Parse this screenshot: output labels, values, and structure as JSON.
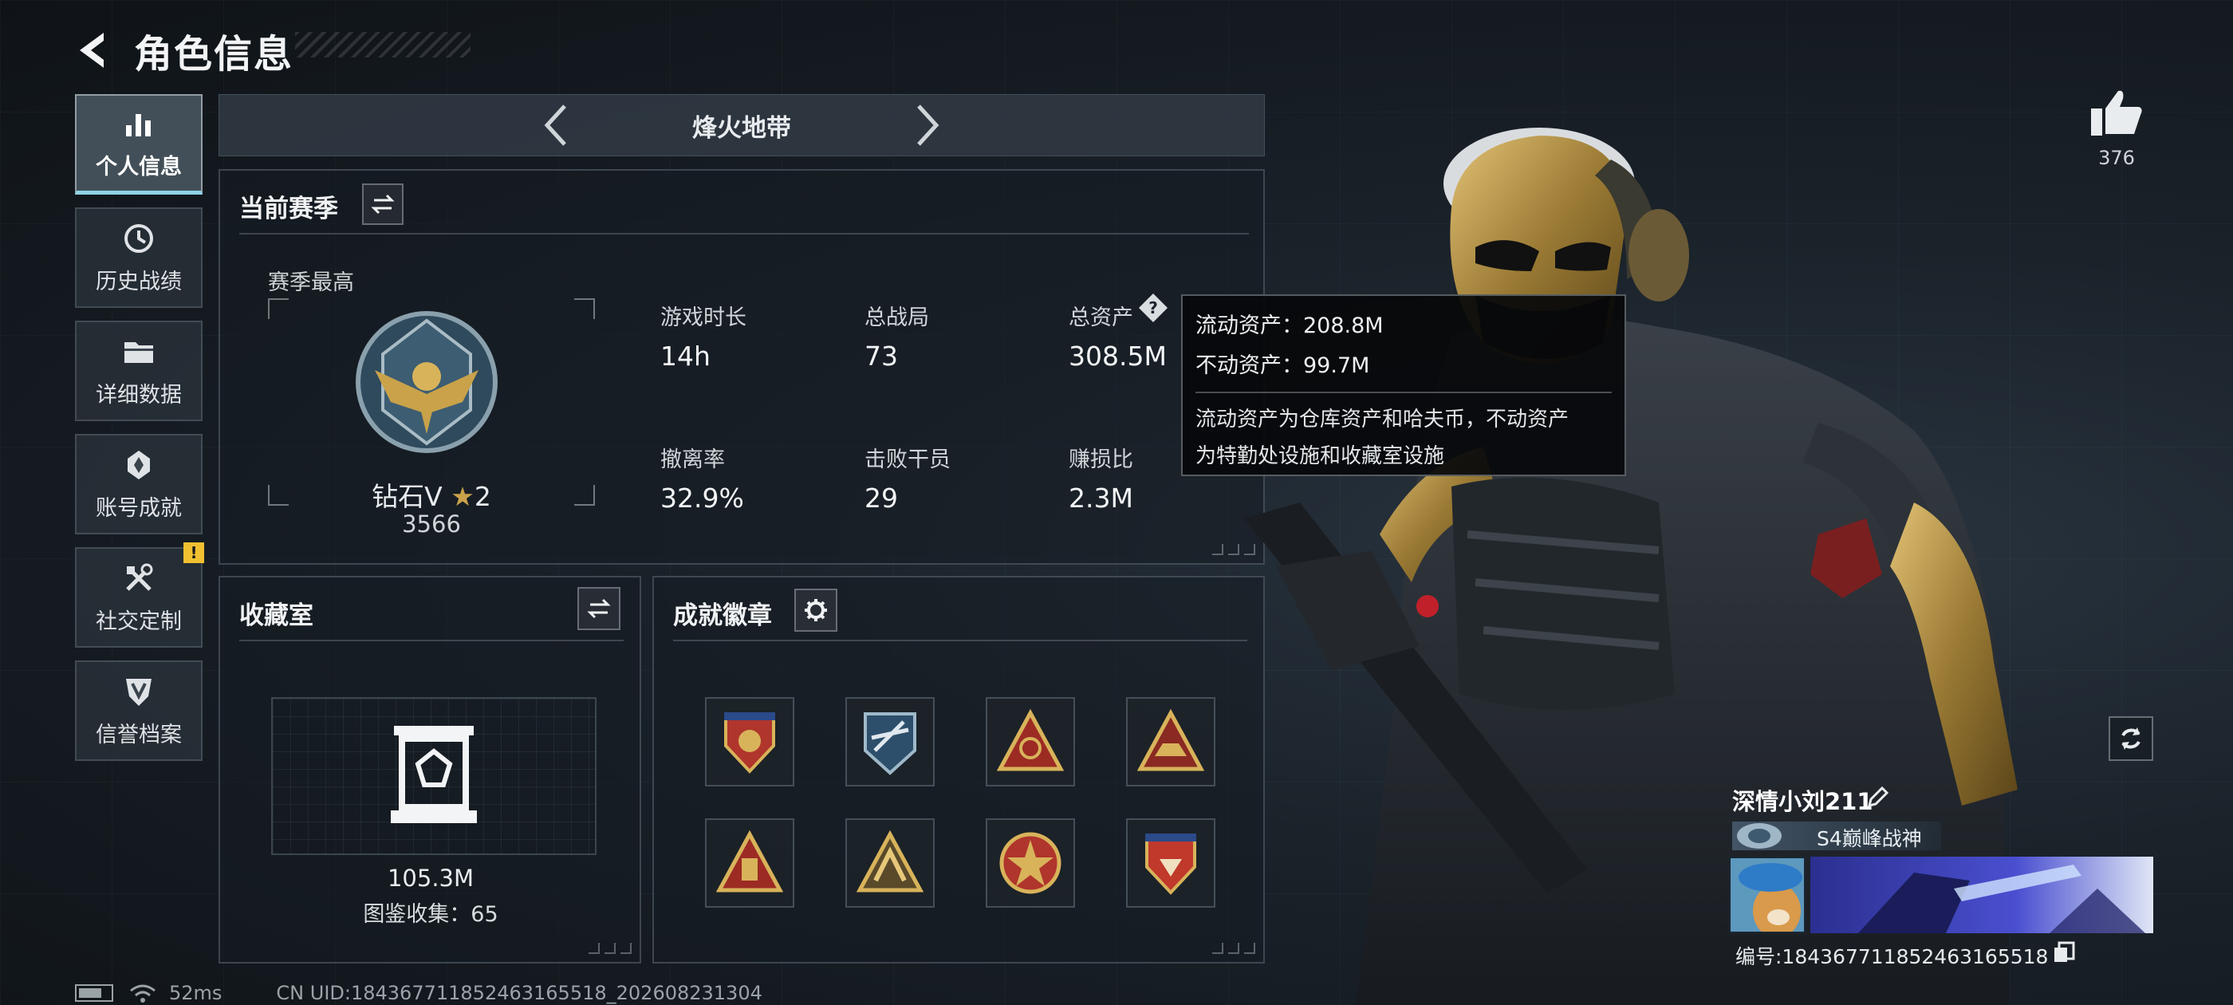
{
  "header": {
    "title": "角色信息"
  },
  "sidebar": {
    "items": [
      {
        "label": "个人信息",
        "icon": "bar-chart-icon",
        "active": true
      },
      {
        "label": "历史战绩",
        "icon": "history-icon"
      },
      {
        "label": "详细数据",
        "icon": "folder-icon"
      },
      {
        "label": "账号成就",
        "icon": "achievement-icon"
      },
      {
        "label": "社交定制",
        "icon": "tools-icon",
        "badge": "!"
      },
      {
        "label": "信誉档案",
        "icon": "shield-icon"
      }
    ]
  },
  "mode": {
    "title": "烽火地带"
  },
  "season": {
    "title": "当前赛季",
    "best_label": "赛季最高",
    "rank_name": "钻石V",
    "rank_stars": "2",
    "rank_points": "3566",
    "stats": [
      {
        "label": "游戏时长",
        "value": "14h"
      },
      {
        "label": "总战局",
        "value": "73"
      },
      {
        "label": "总资产",
        "value": "308.5M"
      },
      {
        "label": "撤离率",
        "value": "32.9%"
      },
      {
        "label": "击败干员",
        "value": "29"
      },
      {
        "label": "赚损比",
        "value": "2.3M"
      }
    ]
  },
  "tooltip": {
    "liquid": "流动资产：208.8M",
    "fixed": "不动资产：99.7M",
    "desc_line1": "流动资产为仓库资产和哈夫币，不动资产",
    "desc_line2": "为特勤处设施和收藏室设施"
  },
  "collection": {
    "title": "收藏室",
    "value": "105.3M",
    "count_text": "图鉴收集：65"
  },
  "achievements": {
    "title": "成就徽章",
    "badges": [
      "badge-shield-red",
      "badge-round-blue",
      "badge-triangle-1",
      "badge-triangle-2",
      "badge-triangle-3",
      "badge-triangle-4",
      "badge-round-red",
      "badge-shield-red-2"
    ]
  },
  "likes": {
    "count": "376"
  },
  "player": {
    "name": "深情小刘211",
    "title": "S4巅峰战神",
    "id_text": "编号:1843677118524631655​18"
  },
  "status_bar": {
    "ping": "52ms",
    "uid": "CN UID:184367711852463165518_202608231304"
  },
  "colors": {
    "accent": "#8fd3e6",
    "gold": "#c9a24a",
    "panel_bg": "#1b232b",
    "warning": "#f0c030"
  }
}
